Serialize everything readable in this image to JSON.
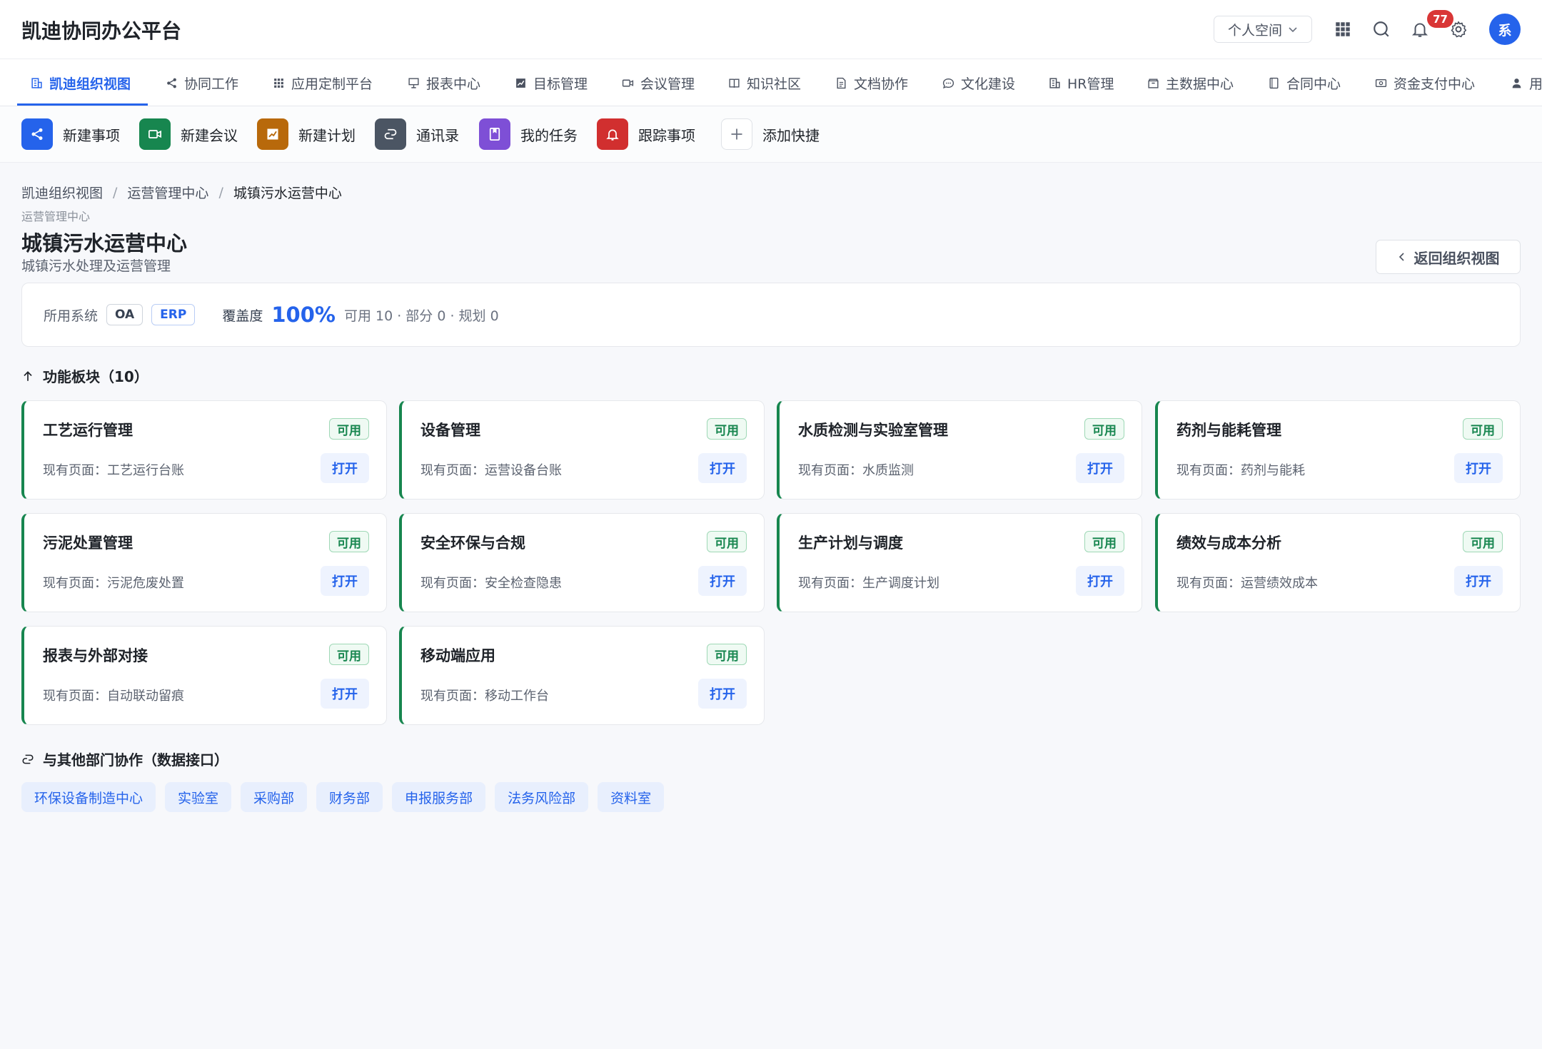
{
  "header": {
    "app_title": "凯迪协同办公平台",
    "space_label": "个人空间",
    "notification_count": "77",
    "avatar_text": "系"
  },
  "nav": {
    "tabs": [
      {
        "label": "凯迪组织视图",
        "icon": "building-icon",
        "active": true
      },
      {
        "label": "协同工作",
        "icon": "share-icon"
      },
      {
        "label": "应用定制平台",
        "icon": "grid-icon"
      },
      {
        "label": "报表中心",
        "icon": "presentation-icon"
      },
      {
        "label": "目标管理",
        "icon": "chart-icon"
      },
      {
        "label": "会议管理",
        "icon": "video-icon"
      },
      {
        "label": "知识社区",
        "icon": "book-icon"
      },
      {
        "label": "文档协作",
        "icon": "document-icon"
      },
      {
        "label": "文化建设",
        "icon": "chat-icon"
      },
      {
        "label": "HR管理",
        "icon": "building-icon"
      },
      {
        "label": "主数据中心",
        "icon": "archive-icon"
      },
      {
        "label": "合同中心",
        "icon": "contract-icon"
      },
      {
        "label": "资金支付中心",
        "icon": "payment-icon"
      },
      {
        "label": "用",
        "icon": "user-icon"
      }
    ]
  },
  "quick_actions": [
    {
      "label": "新建事项",
      "icon": "share-icon",
      "color": "#2563eb"
    },
    {
      "label": "新建会议",
      "icon": "video-icon",
      "color": "#17864f"
    },
    {
      "label": "新建计划",
      "icon": "chart-icon",
      "color": "#b8690b"
    },
    {
      "label": "通讯录",
      "icon": "contacts-icon",
      "color": "#4b5563"
    },
    {
      "label": "我的任务",
      "icon": "bookmark-icon",
      "color": "#7e4fd6"
    },
    {
      "label": "跟踪事项",
      "icon": "bell-icon",
      "color": "#d12f2f"
    },
    {
      "label": "添加快捷",
      "icon": "plus-icon",
      "color": "#ffffff"
    }
  ],
  "breadcrumb": [
    "凯迪组织视图",
    "运营管理中心",
    "城镇污水运营中心"
  ],
  "page": {
    "parent_label": "运营管理中心",
    "title": "城镇污水运营中心",
    "subtitle": "城镇污水处理及运营管理",
    "back_label": "返回组织视图"
  },
  "systems": {
    "label": "所用系统",
    "tags": [
      "OA",
      "ERP"
    ],
    "coverage_label": "覆盖度",
    "coverage_value": "100%",
    "coverage_detail": "可用 10 · 部分 0 · 规划 0"
  },
  "modules_section": {
    "title": "功能板块（10）",
    "items": [
      {
        "title": "工艺运行管理",
        "status": "可用",
        "page": "现有页面：工艺运行台账",
        "action": "打开"
      },
      {
        "title": "设备管理",
        "status": "可用",
        "page": "现有页面：运营设备台账",
        "action": "打开"
      },
      {
        "title": "水质检测与实验室管理",
        "status": "可用",
        "page": "现有页面：水质监测",
        "action": "打开"
      },
      {
        "title": "药剂与能耗管理",
        "status": "可用",
        "page": "现有页面：药剂与能耗",
        "action": "打开"
      },
      {
        "title": "污泥处置管理",
        "status": "可用",
        "page": "现有页面：污泥危废处置",
        "action": "打开"
      },
      {
        "title": "安全环保与合规",
        "status": "可用",
        "page": "现有页面：安全检查隐患",
        "action": "打开"
      },
      {
        "title": "生产计划与调度",
        "status": "可用",
        "page": "现有页面：生产调度计划",
        "action": "打开"
      },
      {
        "title": "绩效与成本分析",
        "status": "可用",
        "page": "现有页面：运营绩效成本",
        "action": "打开"
      },
      {
        "title": "报表与外部对接",
        "status": "可用",
        "page": "现有页面：自动联动留痕",
        "action": "打开"
      },
      {
        "title": "移动端应用",
        "status": "可用",
        "page": "现有页面：移动工作台",
        "action": "打开"
      }
    ]
  },
  "collab_section": {
    "title": "与其他部门协作（数据接口）",
    "departments": [
      "环保设备制造中心",
      "实验室",
      "采购部",
      "财务部",
      "申报服务部",
      "法务风险部",
      "资料室"
    ]
  },
  "colors": {
    "accent": "#2563eb",
    "available": "#17864f"
  }
}
